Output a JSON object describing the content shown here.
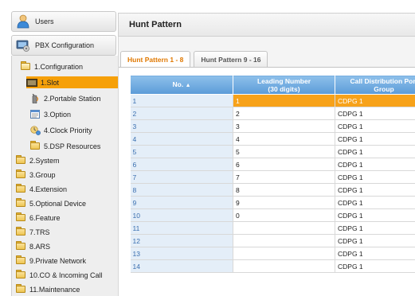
{
  "sidebar": {
    "users_label": "Users",
    "pbx_label": "PBX Configuration",
    "tree": [
      {
        "label": "1.Configuration",
        "icon": "folder-open-icon"
      },
      {
        "label": "1.Slot",
        "icon": "slot-icon"
      },
      {
        "label": "2.Portable Station",
        "icon": "portable-station-icon"
      },
      {
        "label": "3.Option",
        "icon": "option-icon"
      },
      {
        "label": "4.Clock Priority",
        "icon": "clock-priority-icon"
      },
      {
        "label": "5.DSP Resources",
        "icon": "folder-icon"
      },
      {
        "label": "2.System",
        "icon": "folder-icon"
      },
      {
        "label": "3.Group",
        "icon": "folder-icon"
      },
      {
        "label": "4.Extension",
        "icon": "folder-icon"
      },
      {
        "label": "5.Optional Device",
        "icon": "folder-icon"
      },
      {
        "label": "6.Feature",
        "icon": "folder-icon"
      },
      {
        "label": "7.TRS",
        "icon": "folder-icon"
      },
      {
        "label": "8.ARS",
        "icon": "folder-icon"
      },
      {
        "label": "9.Private Network",
        "icon": "folder-icon"
      },
      {
        "label": "10.CO & Incoming Call",
        "icon": "folder-icon"
      },
      {
        "label": "11.Maintenance",
        "icon": "folder-icon"
      }
    ]
  },
  "main": {
    "title": "Hunt Pattern",
    "tabs": [
      {
        "label": "Hunt Pattern 1 - 8",
        "active": true
      },
      {
        "label": "Hunt Pattern 9 - 16",
        "active": false
      }
    ],
    "table": {
      "headers": {
        "no": "No.",
        "leading_line1": "Leading Number",
        "leading_line2": "(30 digits)",
        "cdpg_line1": "Call Distribution Port",
        "cdpg_line2": "Group"
      },
      "rows": [
        {
          "no": "1",
          "leading": "1",
          "cdpg": "CDPG 1"
        },
        {
          "no": "2",
          "leading": "2",
          "cdpg": "CDPG 1"
        },
        {
          "no": "3",
          "leading": "3",
          "cdpg": "CDPG 1"
        },
        {
          "no": "4",
          "leading": "4",
          "cdpg": "CDPG 1"
        },
        {
          "no": "5",
          "leading": "5",
          "cdpg": "CDPG 1"
        },
        {
          "no": "6",
          "leading": "6",
          "cdpg": "CDPG 1"
        },
        {
          "no": "7",
          "leading": "7",
          "cdpg": "CDPG 1"
        },
        {
          "no": "8",
          "leading": "8",
          "cdpg": "CDPG 1"
        },
        {
          "no": "9",
          "leading": "9",
          "cdpg": "CDPG 1"
        },
        {
          "no": "10",
          "leading": "0",
          "cdpg": "CDPG 1"
        },
        {
          "no": "11",
          "leading": "",
          "cdpg": "CDPG 1"
        },
        {
          "no": "12",
          "leading": "",
          "cdpg": "CDPG 1"
        },
        {
          "no": "13",
          "leading": "",
          "cdpg": "CDPG 1"
        },
        {
          "no": "14",
          "leading": "",
          "cdpg": "CDPG 1"
        }
      ]
    }
  },
  "colors": {
    "accent_orange": "#f6a009",
    "header_blue": "#5b9bd8"
  }
}
